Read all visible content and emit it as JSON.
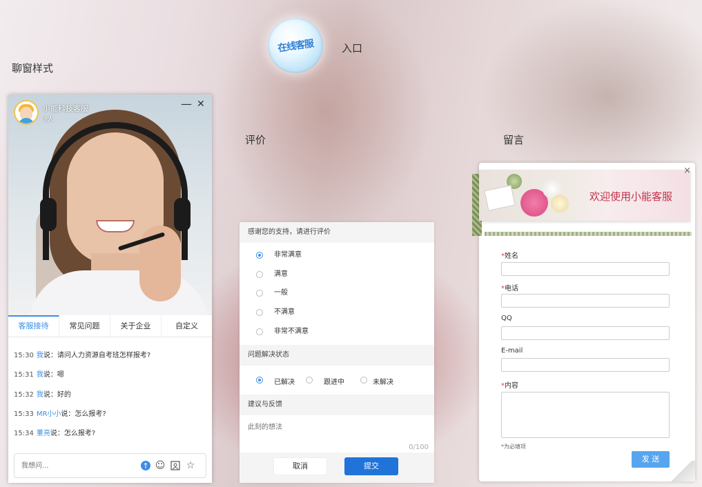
{
  "labels": {
    "chat_style": "聊窗样式",
    "entry": "入口",
    "rating": "评价",
    "leave_message": "留言"
  },
  "entry_logo": {
    "text": "在线客服"
  },
  "chat": {
    "agent_name": "小能科技客服",
    "agent_count": "3人",
    "minimize": "—",
    "close": "✕",
    "tabs": [
      {
        "label": "客服接待",
        "active": true
      },
      {
        "label": "常见问题",
        "active": false
      },
      {
        "label": "关于企业",
        "active": false
      },
      {
        "label": "自定义",
        "active": false
      }
    ],
    "messages": [
      {
        "time": "15:30",
        "who": "我",
        "say": "说：",
        "text": "请问人力资源自考班怎样报考?"
      },
      {
        "time": "15:31",
        "who": "我",
        "say": "说：",
        "text": "嗯"
      },
      {
        "time": "15:32",
        "who": "我",
        "say": "说：",
        "text": "好的"
      },
      {
        "time": "15:33",
        "who": "MR小小",
        "say": "说：",
        "text": "怎么报考?"
      },
      {
        "time": "15:34",
        "who": "董亮",
        "say": "说：",
        "text": "怎么报考?"
      }
    ],
    "input_placeholder": "我想问..."
  },
  "rating": {
    "header": "感谢您的支持，请进行评价",
    "options": [
      {
        "label": "非常满意",
        "checked": true
      },
      {
        "label": "满意",
        "checked": false
      },
      {
        "label": "一般",
        "checked": false
      },
      {
        "label": "不满意",
        "checked": false
      },
      {
        "label": "非常不满意",
        "checked": false
      }
    ],
    "status_header": "问题解决状态",
    "status_options": [
      {
        "label": "已解决",
        "checked": true
      },
      {
        "label": "跟进中",
        "checked": false
      },
      {
        "label": "未解决",
        "checked": false
      }
    ],
    "feedback_header": "建议与反馈",
    "feedback_placeholder": "此刻的想法",
    "char_count": "0/100",
    "cancel": "取消",
    "submit": "提交"
  },
  "leave": {
    "banner_title": "欢迎使用小能客服",
    "close": "×",
    "fields": [
      {
        "label": "姓名",
        "required": true
      },
      {
        "label": "电话",
        "required": true
      },
      {
        "label": "QQ",
        "required": false
      },
      {
        "label": "E-mail",
        "required": false
      },
      {
        "label": "内容",
        "required": true
      }
    ],
    "required_marker": "*",
    "note": "*为必填项",
    "send": "发 送"
  },
  "colors": {
    "accent": "#3a8ee6",
    "submit": "#1f73d9",
    "send": "#58a5ef",
    "required": "#e33",
    "banner_title": "#c0334b"
  }
}
